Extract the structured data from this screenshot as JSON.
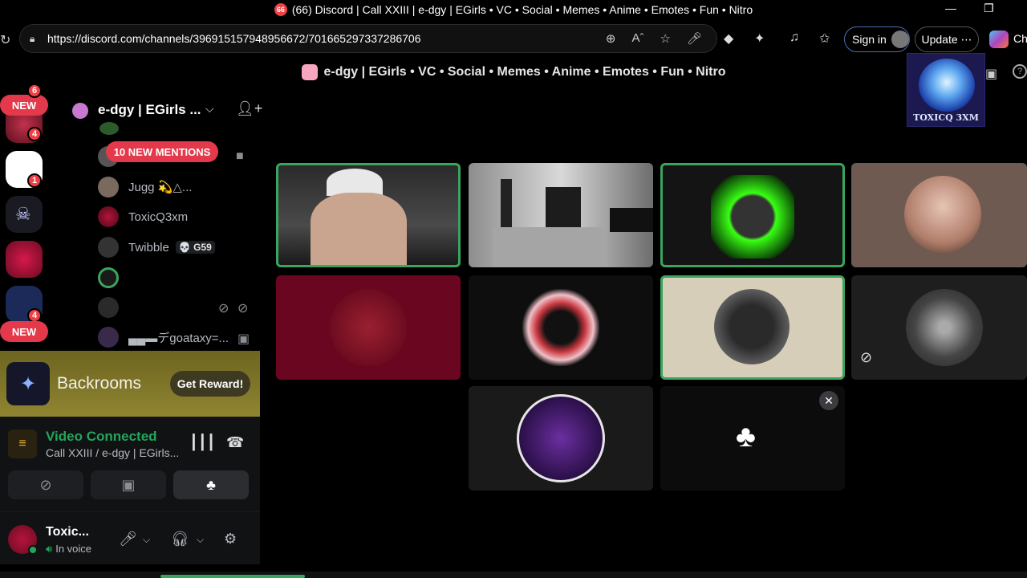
{
  "browser": {
    "tab_badge": "66",
    "window_title": "(66) Discord | Call XXIII | e-dgy | EGirls • VC • Social • Memes • Anime • Emotes • Fun • Nitro",
    "url": "https://discord.com/channels/396915157948956672/701665297337286706",
    "sign_in_label": "Sign in",
    "update_label": "Update",
    "profile_cut_label": "Ch"
  },
  "header": {
    "guild_title": "e-dgy | EGirls • VC • Social • Memes • Anime • Emotes • Fun • Nitro"
  },
  "overlay": {
    "label": "TOXICQ 3XM"
  },
  "rail": {
    "new_label": "NEW",
    "badges": [
      "6",
      "4",
      "1",
      "4"
    ]
  },
  "sidebar": {
    "guild_name": "e-dgy | EGirls ...",
    "mentions_label": "10 NEW MENTIONS",
    "voice_users": [
      {
        "name": "Jugg 💫△..."
      },
      {
        "name": "ToxicQ3xm"
      },
      {
        "name": "Twibble",
        "tag": "💀 G59"
      },
      {
        "name": ""
      },
      {
        "name": ""
      },
      {
        "name": "▄▄▬デgoataxy=..."
      }
    ]
  },
  "promo": {
    "title": "Backrooms",
    "reward_label": "Get Reward!"
  },
  "voice": {
    "status": "Video Connected",
    "channel": "Call XXIII / e-dgy | EGirls..."
  },
  "user": {
    "name": "Toxic...",
    "status": "In voice"
  },
  "colors": {
    "discord_green": "#3ba55d",
    "mention_red": "#e4394a",
    "promo_gold": "#8f8531"
  }
}
